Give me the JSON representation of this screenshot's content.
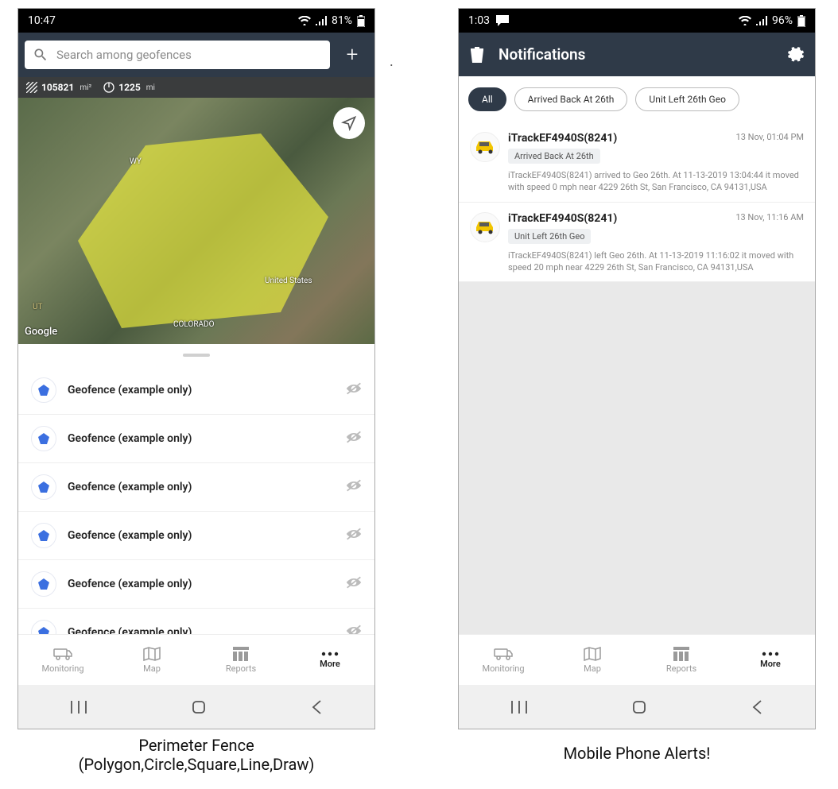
{
  "phone1": {
    "status": {
      "time": "10:47",
      "battery": "81%"
    },
    "search": {
      "placeholder": "Search among geofences"
    },
    "info": {
      "area": "105821",
      "area_unit": "mi²",
      "perimeter": "1225",
      "perimeter_unit": "mi"
    },
    "map_labels": {
      "wy": "WY",
      "ut": "UT",
      "colorado": "COLORADO",
      "us": "United States",
      "google": "Google"
    },
    "list": [
      {
        "label": "Geofence (example only)"
      },
      {
        "label": "Geofence (example only)"
      },
      {
        "label": "Geofence (example only)"
      },
      {
        "label": "Geofence (example only)"
      },
      {
        "label": "Geofence (example only)"
      },
      {
        "label": "Geofence (example only)"
      }
    ],
    "tabs": {
      "monitoring": "Monitoring",
      "map": "Map",
      "reports": "Reports",
      "more": "More"
    }
  },
  "phone2": {
    "status": {
      "time": "1:03",
      "battery": "96%"
    },
    "title": "Notifications",
    "chips": {
      "all": "All",
      "arrived": "Arrived Back At 26th",
      "left": "Unit Left 26th Geo"
    },
    "notifications": [
      {
        "title": "iTrackEF4940S(8241)",
        "tag": "Arrived Back At 26th",
        "time": "13 Nov, 01:04 PM",
        "body": "iTrackEF4940S(8241) arrived to Geo 26th.    At 11-13-2019 13:04:44 it moved with speed 0 mph near 4229 26th St, San Francisco, CA 94131,USA"
      },
      {
        "title": "iTrackEF4940S(8241)",
        "tag": "Unit Left 26th Geo",
        "time": "13 Nov, 11:16 AM",
        "body": "iTrackEF4940S(8241) left Geo 26th.    At 11-13-2019 11:16:02 it moved with speed 20 mph near 4229 26th St, San Francisco, CA 94131,USA"
      }
    ],
    "tabs": {
      "monitoring": "Monitoring",
      "map": "Map",
      "reports": "Reports",
      "more": "More"
    }
  },
  "captions": {
    "c1a": "Perimeter Fence",
    "c1b": "(Polygon,Circle,Square,Line,Draw)",
    "c2": "Mobile Phone Alerts!"
  }
}
